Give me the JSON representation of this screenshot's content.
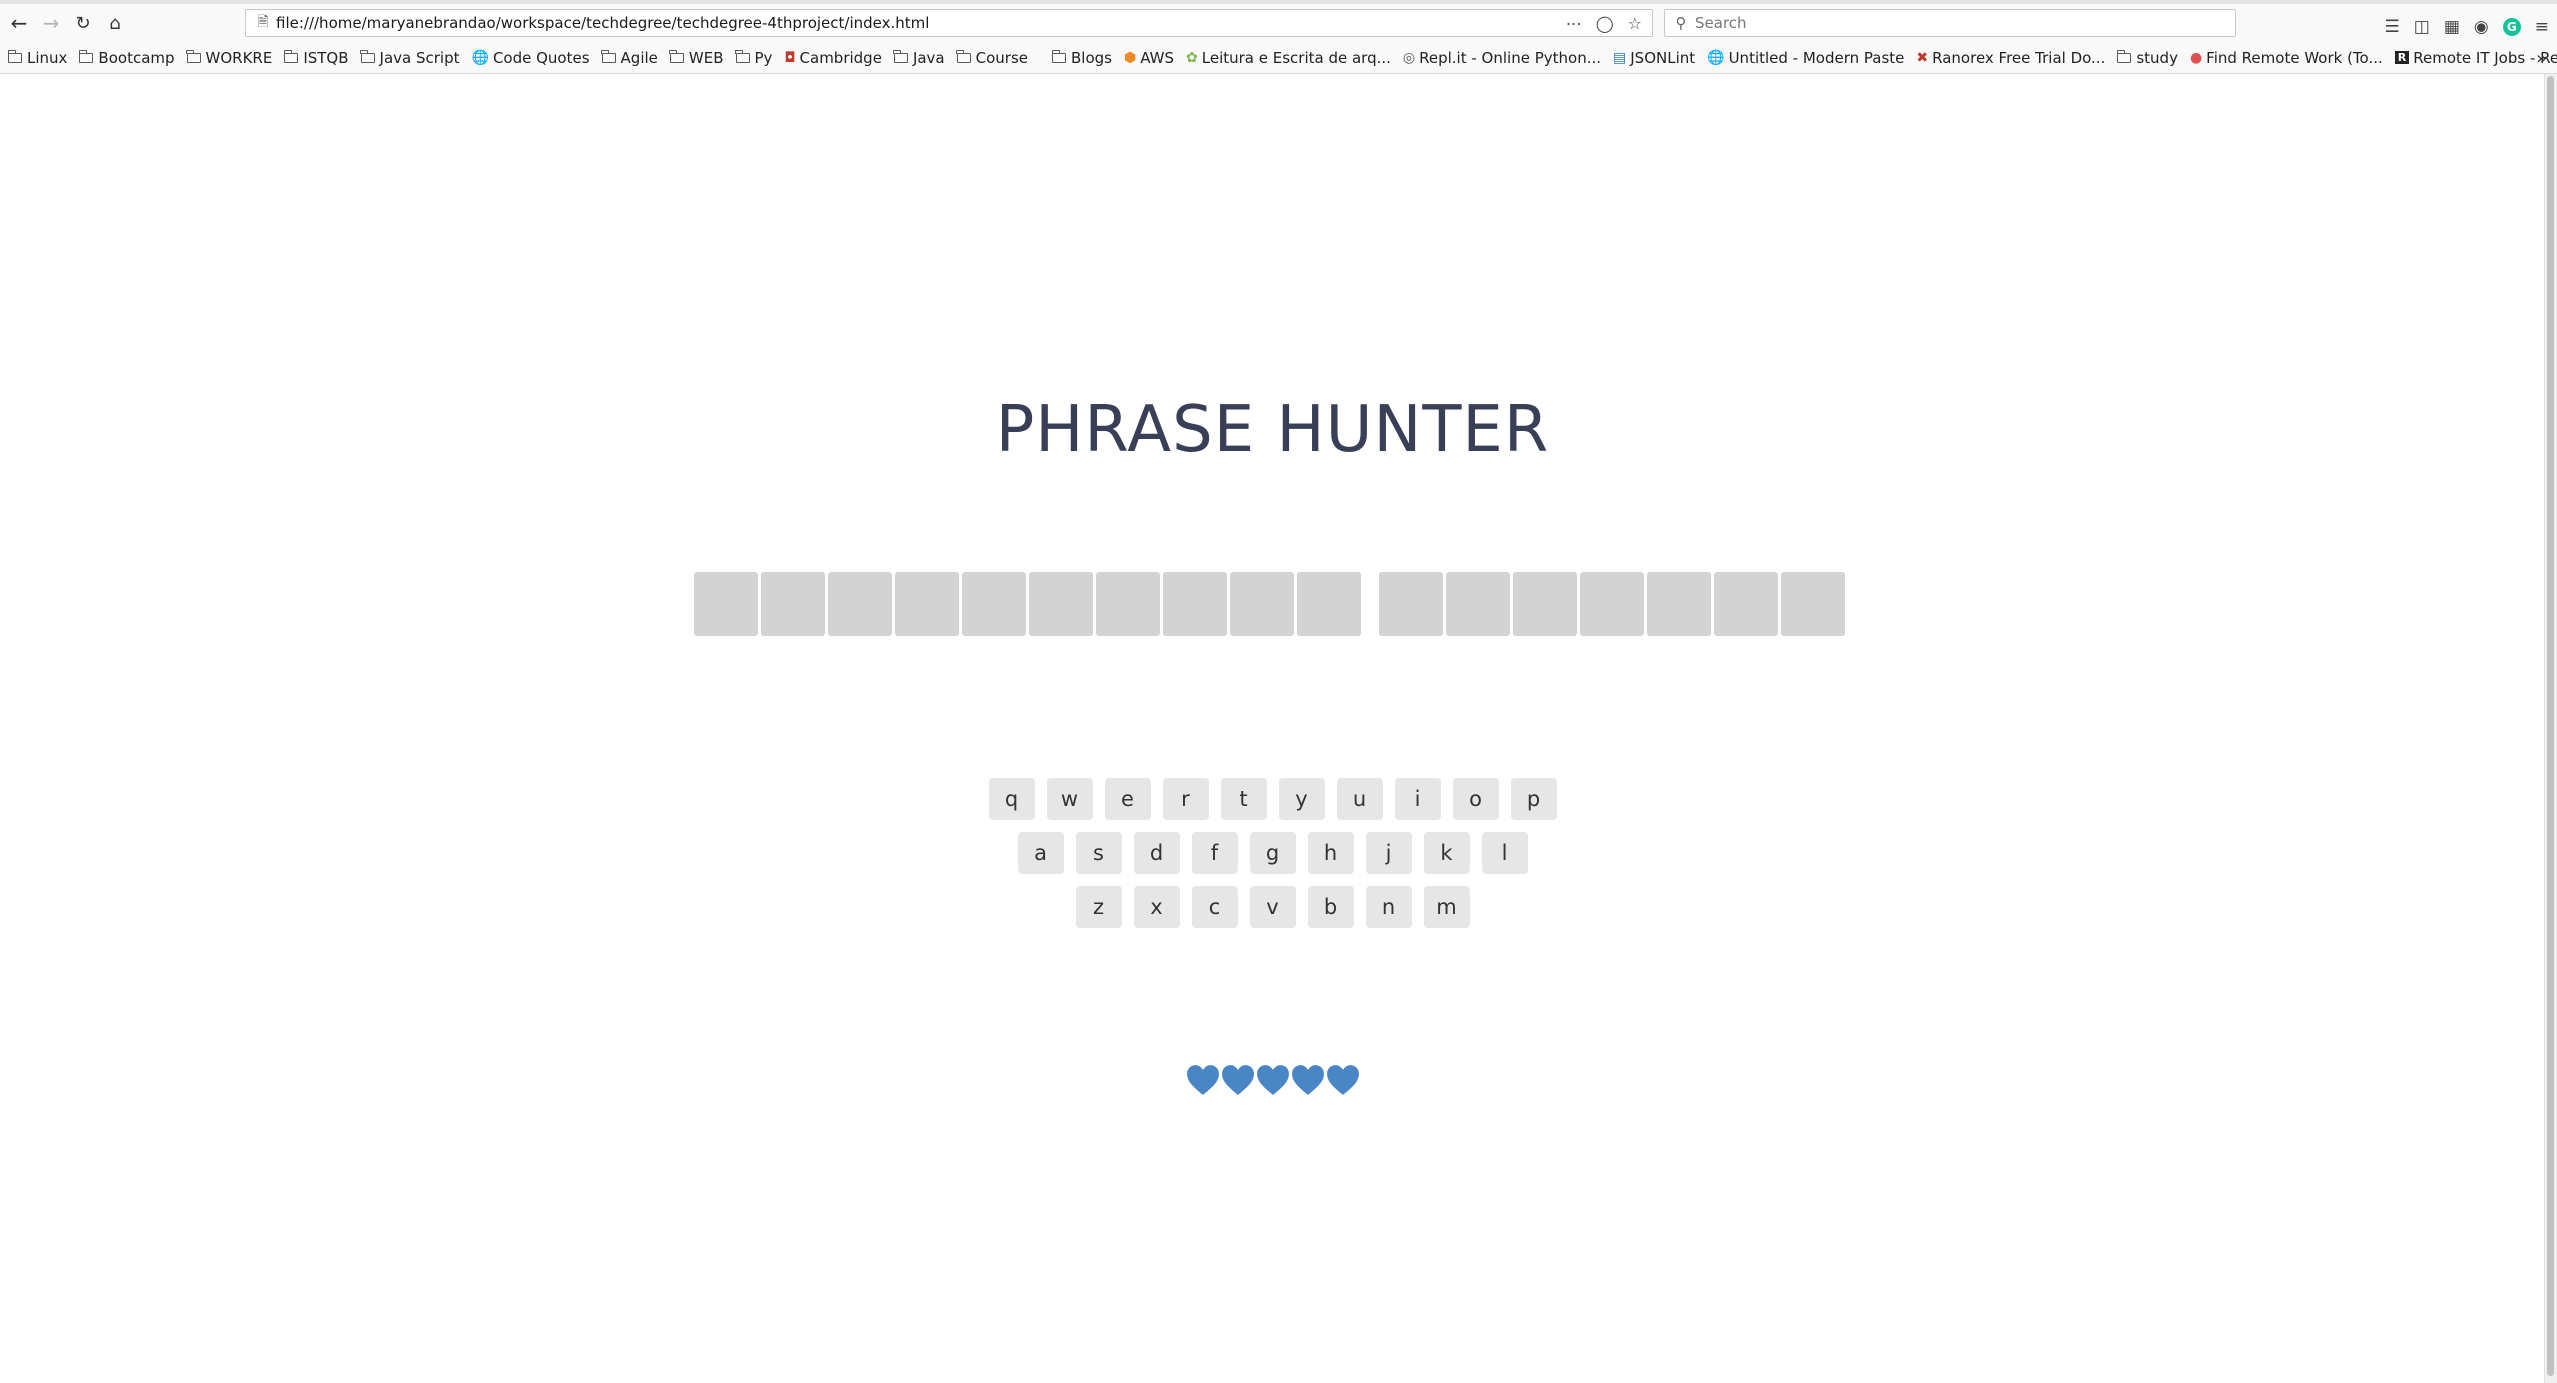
{
  "browser": {
    "url": "file:///home/maryanebrandao/workspace/techdegree/techdegree-4thproject/index.html",
    "search_placeholder": "Search",
    "bookmarks": [
      {
        "label": "Linux",
        "icon": "folder-icon"
      },
      {
        "label": "Bootcamp",
        "icon": "folder-icon"
      },
      {
        "label": "WORKRE",
        "icon": "folder-icon"
      },
      {
        "label": "ISTQB",
        "icon": "folder-icon"
      },
      {
        "label": "Java Script",
        "icon": "folder-icon"
      },
      {
        "label": "Code Quotes",
        "icon": "globe-icon"
      },
      {
        "label": "Agile",
        "icon": "folder-icon"
      },
      {
        "label": "WEB",
        "icon": "folder-icon"
      },
      {
        "label": "Py",
        "icon": "folder-icon"
      },
      {
        "label": "Cambridge",
        "icon": "shield-icon"
      },
      {
        "label": "Java",
        "icon": "folder-icon"
      },
      {
        "label": "Course",
        "icon": "folder-icon"
      },
      {
        "label": "Blogs",
        "icon": "folder-icon"
      },
      {
        "label": "AWS",
        "icon": "aws-icon"
      },
      {
        "label": "Leitura e Escrita de arq...",
        "icon": "leaf-icon"
      },
      {
        "label": "Repl.it - Online Python...",
        "icon": "replit-icon"
      },
      {
        "label": "JSONLint",
        "icon": "jsonlint-icon"
      },
      {
        "label": "Untitled - Modern Paste",
        "icon": "globe-icon"
      },
      {
        "label": "Ranorex Free Trial Do...",
        "icon": "ranorex-icon"
      },
      {
        "label": "study",
        "icon": "folder-icon"
      },
      {
        "label": "Find Remote Work (To...",
        "icon": "remote-icon"
      },
      {
        "label": "Remote IT Jobs - Rem...",
        "icon": "r-icon"
      }
    ]
  },
  "game": {
    "title": "PHRASE HUNTER",
    "phrase_words": [
      10,
      7
    ],
    "keyboard_rows": [
      [
        "q",
        "w",
        "e",
        "r",
        "t",
        "y",
        "u",
        "i",
        "o",
        "p"
      ],
      [
        "a",
        "s",
        "d",
        "f",
        "g",
        "h",
        "j",
        "k",
        "l"
      ],
      [
        "z",
        "x",
        "c",
        "v",
        "b",
        "n",
        "m"
      ]
    ],
    "lives": 5,
    "heart_color": "#4a86c5",
    "title_color": "#3a3f58",
    "tile_color": "#d3d3d3",
    "key_color": "#e6e6e6"
  }
}
